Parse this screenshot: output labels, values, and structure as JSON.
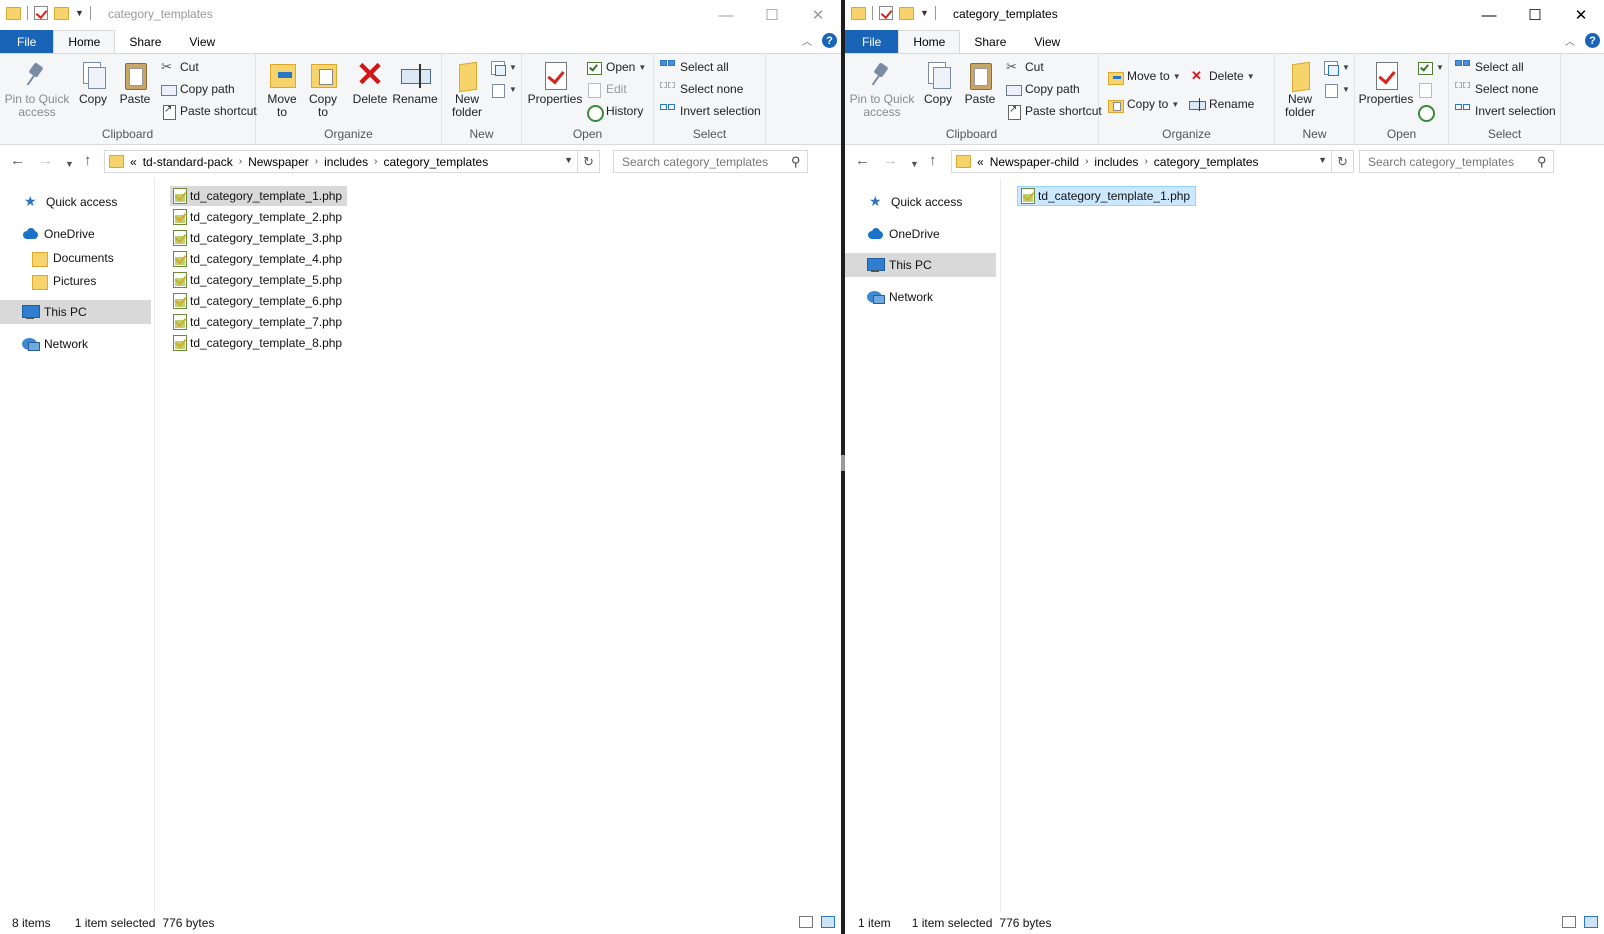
{
  "left": {
    "title": "category_templates",
    "tabs": {
      "file": "File",
      "home": "Home",
      "share": "Share",
      "view": "View"
    },
    "ribbon": {
      "pin": "Pin to Quick access",
      "copy": "Copy",
      "paste": "Paste",
      "cut": "Cut",
      "copy_path": "Copy path",
      "paste_shortcut": "Paste shortcut",
      "clipboard": "Clipboard",
      "move_to": "Move to",
      "copy_to": "Copy to",
      "delete": "Delete",
      "rename": "Rename",
      "organize": "Organize",
      "new_folder": "New folder",
      "new": "New",
      "properties": "Properties",
      "open_btn": "Open",
      "edit": "Edit",
      "history": "History",
      "open": "Open",
      "select_all": "Select all",
      "select_none": "Select none",
      "invert": "Invert selection",
      "select": "Select"
    },
    "address": {
      "prefix": "«",
      "crumbs": [
        "td-standard-pack",
        "Newspaper",
        "includes",
        "category_templates"
      ]
    },
    "search_placeholder": "Search category_templates",
    "nav": {
      "quick_access": "Quick access",
      "onedrive": "OneDrive",
      "documents": "Documents",
      "pictures": "Pictures",
      "this_pc": "This PC",
      "network": "Network"
    },
    "files": [
      "td_category_template_1.php",
      "td_category_template_2.php",
      "td_category_template_3.php",
      "td_category_template_4.php",
      "td_category_template_5.php",
      "td_category_template_6.php",
      "td_category_template_7.php",
      "td_category_template_8.php"
    ],
    "status": {
      "items": "8 items",
      "selected": "1 item selected",
      "size": "776 bytes"
    }
  },
  "right": {
    "title": "category_templates",
    "tabs": {
      "file": "File",
      "home": "Home",
      "share": "Share",
      "view": "View"
    },
    "ribbon": {
      "pin": "Pin to Quick access",
      "copy": "Copy",
      "paste": "Paste",
      "cut": "Cut",
      "copy_path": "Copy path",
      "paste_shortcut": "Paste shortcut",
      "clipboard": "Clipboard",
      "move_to": "Move to",
      "copy_to": "Copy to",
      "delete": "Delete",
      "rename": "Rename",
      "organize": "Organize",
      "new_folder": "New folder",
      "new": "New",
      "properties": "Properties",
      "open": "Open",
      "select_all": "Select all",
      "select_none": "Select none",
      "invert": "Invert selection",
      "select": "Select"
    },
    "address": {
      "prefix": "«",
      "crumbs": [
        "Newspaper-child",
        "includes",
        "category_templates"
      ]
    },
    "search_placeholder": "Search category_templates",
    "nav": {
      "quick_access": "Quick access",
      "onedrive": "OneDrive",
      "this_pc": "This PC",
      "network": "Network"
    },
    "files": [
      "td_category_template_1.php"
    ],
    "status": {
      "items": "1 item",
      "selected": "1 item selected",
      "size": "776 bytes"
    }
  },
  "icons": {
    "help": "?",
    "close": "✕",
    "maximize": "☐",
    "minimize": "—",
    "back": "←",
    "forward": "→",
    "up": "↑",
    "refresh": "↻",
    "search": "⚲"
  },
  "colors": {
    "accent": "#1a64b7",
    "selection": "#cce8ff",
    "inactive_selection": "#d9d9d9"
  }
}
